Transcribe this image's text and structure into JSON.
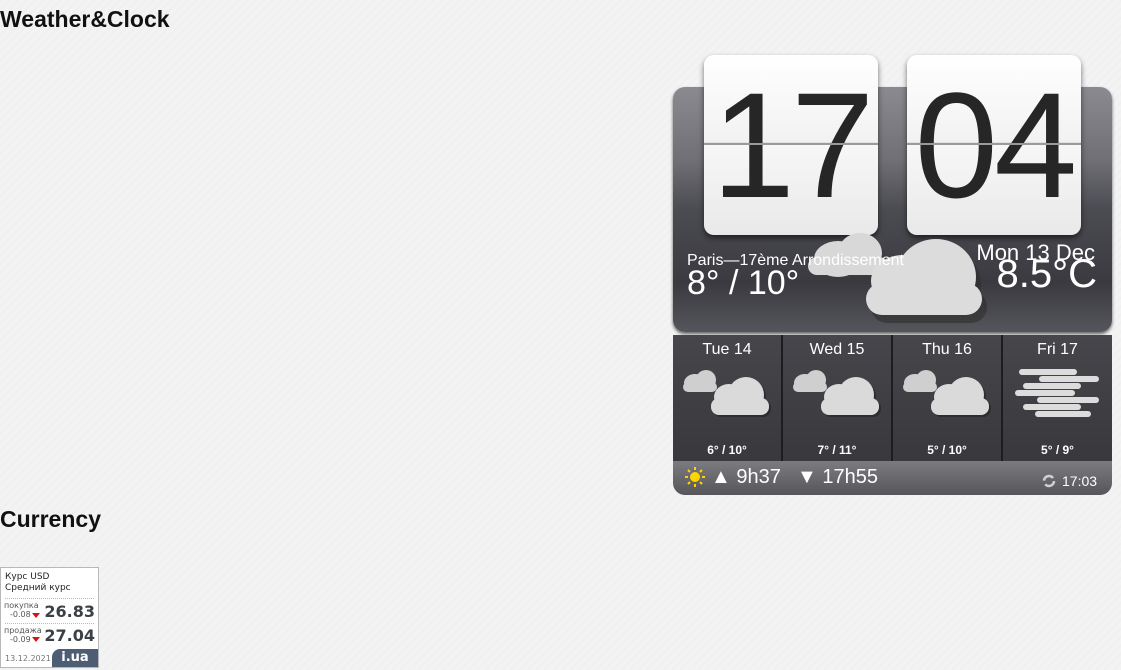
{
  "headings": {
    "weather": "Weather&Clock",
    "currency": "Currency"
  },
  "clock": {
    "hours": "17",
    "minutes": "04"
  },
  "weather": {
    "location": "Paris—17ème Arrondissement",
    "date": "Mon 13 Dec",
    "temperature": "8.5°C",
    "today_range": "8° / 10°",
    "today_icon": "cloudy-icon",
    "forecast": [
      {
        "day": "Tue 14",
        "range": "6° / 10°",
        "icon": "cloudy-icon"
      },
      {
        "day": "Wed 15",
        "range": "7° / 11°",
        "icon": "cloudy-icon"
      },
      {
        "day": "Thu 16",
        "range": "5° / 10°",
        "icon": "cloudy-icon"
      },
      {
        "day": "Fri 17",
        "range": "5° / 9°",
        "icon": "fog-icon"
      }
    ],
    "sunrise": "▲ 9h37",
    "sunset": "▼ 17h55",
    "updated": "17:03"
  },
  "currency": {
    "title": "Курс USD",
    "subtitle": "Средний курс",
    "buy_label": "покупка",
    "buy_change": "-0.08",
    "buy_value": "26.83",
    "sell_label": "продажа",
    "sell_change": "-0.09",
    "sell_value": "27.04",
    "date": "13.12.2021",
    "logo": "i.ua"
  },
  "colors": {
    "panel_dark": "#3a3a40",
    "sun": "#ffd400",
    "change_down": "#dd1111"
  }
}
